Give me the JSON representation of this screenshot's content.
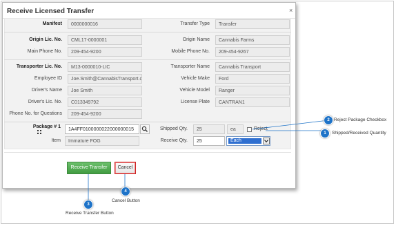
{
  "dialog": {
    "title": "Receive Licensed Transfer",
    "close_label": "×"
  },
  "form": {
    "manifest": {
      "label": "Manifest",
      "value": "0000000016"
    },
    "transfer_type": {
      "label": "Transfer Type",
      "value": "Transfer"
    },
    "origin_lic": {
      "label": "Origin Lic. No.",
      "value": "CML17-0000001"
    },
    "origin_name": {
      "label": "Origin Name",
      "value": "Cannabis Farms"
    },
    "main_phone": {
      "label": "Main Phone No.",
      "value": "209-454-9200"
    },
    "mobile_phone": {
      "label": "Mobile Phone No.",
      "value": "209-454-9267"
    },
    "transporter_lic": {
      "label": "Transporter Lic. No.",
      "value": "M13-0000010-LIC"
    },
    "transporter_name": {
      "label": "Transporter Name",
      "value": "Cannabis Transport"
    },
    "employee_id": {
      "label": "Employee ID",
      "value": "Joe.Smith@CannabisTransport.c"
    },
    "vehicle_make": {
      "label": "Vehicle Make",
      "value": "Ford"
    },
    "driver_name": {
      "label": "Driver's Name",
      "value": "Joe Smith"
    },
    "vehicle_model": {
      "label": "Vehicle Model",
      "value": "Ranger"
    },
    "driver_lic": {
      "label": "Driver's Lic. No.",
      "value": "C013349792"
    },
    "license_plate": {
      "label": "License Plate",
      "value": "CANTRAN1"
    },
    "phone_questions": {
      "label": "Phone No. for Questions",
      "value": "209-454-9200"
    },
    "package": {
      "label": "Package # 1",
      "value": "1A4FF0100000022000000015"
    },
    "shipped_qty": {
      "label": "Shipped Qty.",
      "value": "25",
      "unit": "ea"
    },
    "reject": {
      "label": "Reject",
      "checked": false
    },
    "item": {
      "label": "Item",
      "value": "Immature FOG"
    },
    "receive_qty": {
      "label": "Receive Qty.",
      "value": "25",
      "unit_selected": "Each"
    }
  },
  "buttons": {
    "receive": "Receive Transfer",
    "cancel": "Cancel"
  },
  "callouts": [
    {
      "number": "1",
      "text": "Shipped/Received Quantity"
    },
    {
      "number": "2",
      "text": "Reject Package Checkbox"
    },
    {
      "number": "3",
      "text": "Receive Transfer Button"
    },
    {
      "number": "4",
      "text": "Cancel Button"
    }
  ],
  "colors": {
    "primary_button": "#419b41",
    "callout_badge": "#1e73c8",
    "selected_option": "#2f6fd0"
  }
}
